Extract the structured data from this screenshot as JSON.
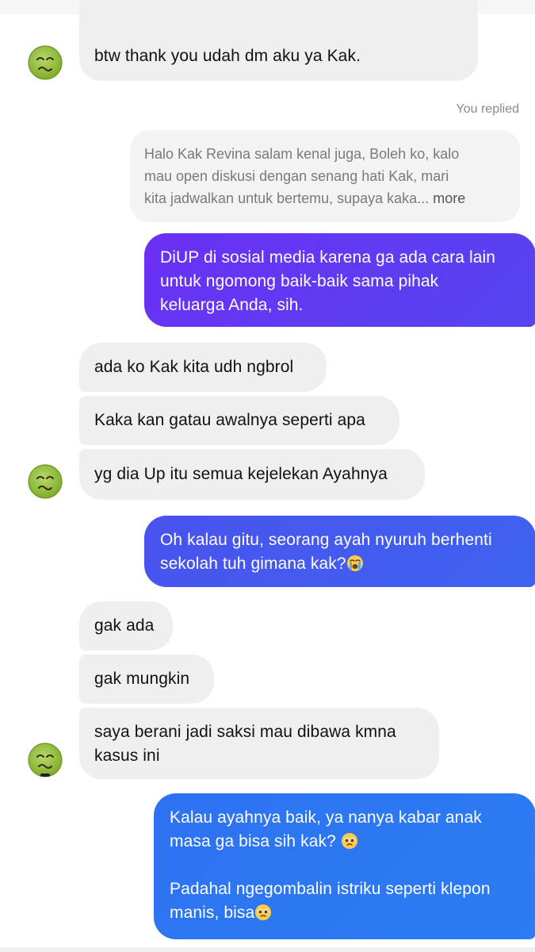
{
  "thread": {
    "top_message": {
      "lines": [
        "btw thank you udah dm aku ya Kak."
      ]
    },
    "replied_meta": "You replied",
    "quoted": {
      "lines": [
        "Halo Kak Revina salam kenal juga, Boleh ko, kalo",
        "mau open diskusi dengan senang hati Kak, mari",
        "kita jadwalkan untuk bertemu, supaya kaka..."
      ],
      "more": "more"
    },
    "out1": {
      "lines": [
        "DiUP di sosial media karena ga ada cara lain",
        "untuk ngomong baik-baik sama pihak",
        "keluarga Anda, sih."
      ]
    },
    "group1": [
      "ada ko Kak kita udh ngbrol",
      "Kaka kan gatau awalnya seperti apa",
      "yg dia Up itu semua kejelekan Ayahnya"
    ],
    "out2": {
      "line1": "Oh kalau gitu, seorang ayah nyuruh berhenti",
      "line2": "sekolah tuh gimana kak?",
      "emoji": "loudly-crying-face-emoji"
    },
    "group2": [
      "gak ada",
      "gak mungkin"
    ],
    "group2_last": {
      "line1": "saya berani jadi saksi mau dibawa kmna",
      "line2": "kasus ini"
    },
    "out3": {
      "line1": "Kalau ayahnya baik, ya nanya kabar anak",
      "line2": "masa ga bisa sih kak?",
      "line3": "Padahal ngegombalin istriku seperti klepon",
      "line4": "manis, bisa",
      "emoji": "pleading-face-emoji"
    },
    "avatar_icon": "nauseated-face-emoji",
    "colors": {
      "incoming_bubble": "#efefef",
      "out1_gradient_start": "#6b2ff5",
      "out1_gradient_end": "#5545f0",
      "out2_gradient_start": "#4a52ef",
      "out2_gradient_end": "#3d63f0",
      "out3_gradient_start": "#2e72f2",
      "out3_gradient_end": "#2b7df3"
    }
  }
}
